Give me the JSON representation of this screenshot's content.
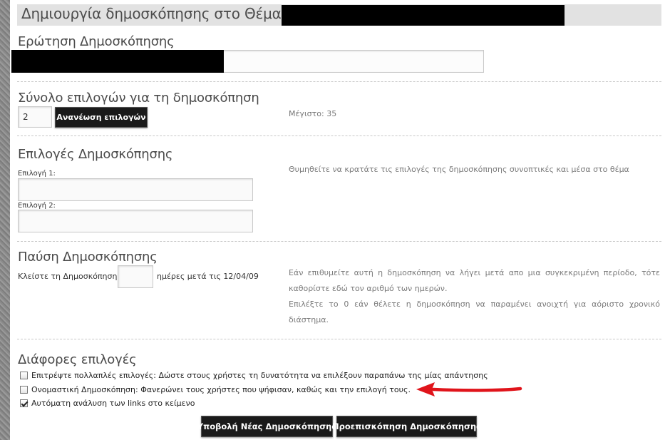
{
  "header": {
    "title": "Δημιουργία δημοσκόπησης στο Θέμα"
  },
  "question_section": {
    "heading": "Ερώτηση Δημοσκόπησης"
  },
  "options_count_section": {
    "heading": "Σύνολο επιλογών για τη δημοσκόπηση",
    "count_value": "2",
    "refresh_button": "Ανανέωση επιλογών",
    "max_text": "Μέγιστο: 35"
  },
  "options_section": {
    "heading": "Επιλογές Δημοσκόπησης",
    "option1_label": "Επιλογή 1:",
    "option2_label": "Επιλογή 2:",
    "hint": "Θυμηθείτε να κρατάτε τις επιλογές της δημοσκόπησης συνοπτικές και μέσα στο θέμα"
  },
  "timeout_section": {
    "heading": "Παύση Δημοσκόπησης",
    "before_text": "Κλείστε τη Δημοσκόπηση",
    "after_text": "ημέρες μετά τις 12/04/09",
    "hint1": "Εάν επιθυμείτε αυτή η δημοσκόπηση να λήγει μετά απο μια συγκεκριμένη περίοδο, τότε καθορίστε εδώ τον αριθμό των ημερών.",
    "hint2": "Επιλέξτε το 0 εάν θέλετε η δημοσκόπηση να παραμένει ανοιχτή για αόριστο χρονικό διάστημα."
  },
  "misc_section": {
    "heading": "Διάφορες επιλογές",
    "options": [
      {
        "label": "Επιτρέψτε πολλαπλές επιλογές: Δώστε στους χρήστες τη δυνατότητα να επιλέξουν παραπάνω της μίας απάντησης",
        "checked": false
      },
      {
        "label": "Ονομαστική Δημοσκόπηση: Φανερώνει τους χρήστες που ψήφισαν, καθώς και την επιλογή τους.",
        "checked": false
      },
      {
        "label": "Αυτόματη ανάλυση των links στο κείμενο",
        "checked": true
      }
    ]
  },
  "footer": {
    "submit_button": "Υποβολή Νέας Δημοσκόπησης",
    "preview_button": "Προεπισκόπηση Δημοσκόπησης"
  },
  "colors": {
    "annotation_arrow": "#e0141b",
    "button_bg": "#1a1a1a",
    "title_bar_bg": "#e2e2e2"
  }
}
